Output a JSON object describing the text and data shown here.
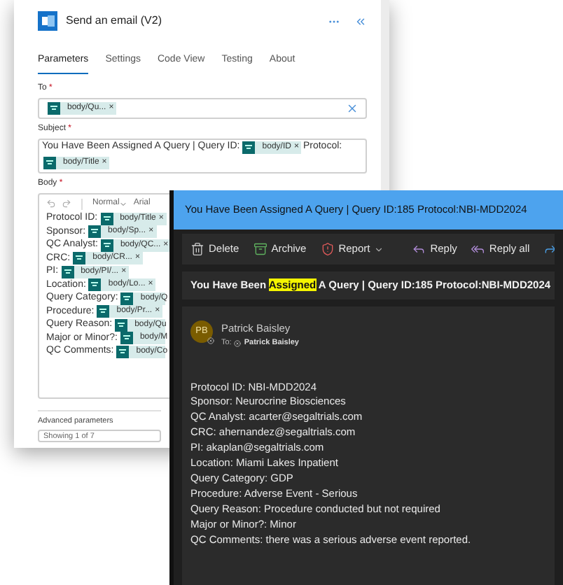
{
  "panel": {
    "title": "Send an email (V2)",
    "tabs": [
      {
        "label": "Parameters",
        "selected": true
      },
      {
        "label": "Settings",
        "selected": false
      },
      {
        "label": "Code View",
        "selected": false
      },
      {
        "label": "Testing",
        "selected": false
      },
      {
        "label": "About",
        "selected": false
      }
    ],
    "to": {
      "label": "To",
      "marker": "*",
      "tokens": [
        {
          "text": "body/Qu...",
          "close": "×"
        }
      ]
    },
    "subject": {
      "label": "Subject",
      "marker": "*",
      "lines": [
        [
          {
            "kind": "text",
            "text": "You Have Been Assigned A Query | Query ID:"
          },
          {
            "kind": "token",
            "text": "body/ID",
            "close": "×"
          },
          {
            "kind": "text",
            "text": "Protocol:"
          }
        ],
        [
          {
            "kind": "token",
            "text": "body/Title",
            "close": "×"
          }
        ]
      ]
    },
    "body": {
      "label": "Body",
      "marker": "*",
      "style": "Normal",
      "font": "Arial",
      "lines": [
        {
          "label": "Protocol ID:",
          "token": {
            "text": "body/Title",
            "close": "×"
          }
        },
        {
          "label": "Sponsor:",
          "token": {
            "text": "body/Sp...",
            "close": "×"
          }
        },
        {
          "label": "QC Analyst:",
          "token": {
            "text": "body/QC...",
            "close": "×"
          }
        },
        {
          "label": "CRC:",
          "token": {
            "text": "body/CR...",
            "close": "×"
          }
        },
        {
          "label": "PI:",
          "token": {
            "text": "body/PI/...",
            "close": "×"
          }
        },
        {
          "label": "Location:",
          "token": {
            "text": "body/Lo...",
            "close": "×"
          }
        },
        {
          "label": "Query Category:",
          "token": {
            "text": "body/Q"
          }
        },
        {
          "label": "Procedure:",
          "token": {
            "text": "body/Pr...",
            "close": "×"
          }
        },
        {
          "label": "Query Reason:",
          "token": {
            "text": "body/Qu"
          }
        },
        {
          "label": "Major or Minor?:",
          "token": {
            "text": "body/M"
          }
        },
        {
          "label": "QC Comments:",
          "token": {
            "text": "body/Co"
          }
        }
      ]
    },
    "advanced": {
      "label": "Advanced parameters",
      "value": "Showing 1 of 7"
    }
  },
  "email": {
    "title": "You Have Been Assigned A Query | Query ID:185 Protocol:NBI-MDD2024",
    "actions": [
      {
        "kind": "delete",
        "label": "Delete"
      },
      {
        "kind": "archive",
        "label": "Archive"
      },
      {
        "kind": "report",
        "label": "Report"
      },
      {
        "kind": "reply",
        "label": "Reply"
      },
      {
        "kind": "replyall",
        "label": "Reply all"
      },
      {
        "kind": "forward"
      }
    ],
    "subject": {
      "before": "You Have Been ",
      "highlight": "Assigned",
      "after": " A Query | Query ID:185 Protocol:NBI-MDD2024"
    },
    "sender": {
      "initials": "PB",
      "name": "Patrick Baisley",
      "to_label": "To:",
      "recipient": "Patrick Baisley"
    },
    "body": [
      "Protocol ID: NBI-MDD2024",
      "Sponsor: Neurocrine Biosciences",
      "QC Analyst: acarter@segaltrials.com",
      "CRC: ahernandez@segaltrials.com",
      "PI: akaplan@segaltrials.com",
      "Location: Miami Lakes Inpatient",
      "Query Category: GDP",
      "Procedure: Adverse Event - Serious",
      "Query Reason: Procedure conducted but not required",
      "Major or Minor?: Minor",
      "QC Comments: there was a serious adverse event reported."
    ]
  }
}
